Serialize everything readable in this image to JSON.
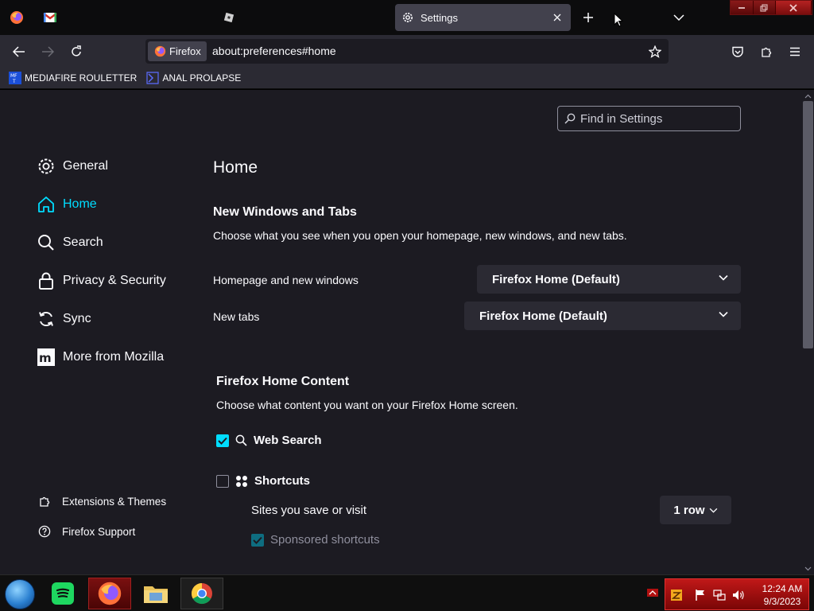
{
  "browser": {
    "active_tab_title": "Settings",
    "identity_label": "Firefox",
    "url": "about:preferences#home"
  },
  "bookmarks": [
    {
      "label": "MEDIAFIRE ROULETTER",
      "icon": "mediafire-icon"
    },
    {
      "label": "ANAL PROLAPSE",
      "icon": "bookmark-page-icon"
    }
  ],
  "settings": {
    "search_placeholder": "Find in Settings",
    "categories": [
      {
        "label": "General",
        "icon": "gear-icon",
        "selected": false
      },
      {
        "label": "Home",
        "icon": "home-icon",
        "selected": true
      },
      {
        "label": "Search",
        "icon": "search-icon",
        "selected": false
      },
      {
        "label": "Privacy & Security",
        "icon": "lock-icon",
        "selected": false
      },
      {
        "label": "Sync",
        "icon": "sync-icon",
        "selected": false
      },
      {
        "label": "More from Mozilla",
        "icon": "mozilla-icon",
        "selected": false
      }
    ],
    "footer_links": [
      {
        "label": "Extensions & Themes",
        "icon": "puzzle-icon"
      },
      {
        "label": "Firefox Support",
        "icon": "help-icon"
      }
    ],
    "page_title": "Home",
    "windows_tabs": {
      "heading": "New Windows and Tabs",
      "description": "Choose what you see when you open your homepage, new windows, and new tabs.",
      "homepage_label": "Homepage and new windows",
      "homepage_value": "Firefox Home (Default)",
      "newtabs_label": "New tabs",
      "newtabs_value": "Firefox Home (Default)"
    },
    "home_content": {
      "heading": "Firefox Home Content",
      "description": "Choose what content you want on your Firefox Home screen.",
      "web_search_label": "Web Search",
      "web_search_checked": true,
      "shortcuts_label": "Shortcuts",
      "shortcuts_checked": false,
      "sites_label": "Sites you save or visit",
      "rows_value": "1 row",
      "sponsored_label": "Sponsored shortcuts",
      "sponsored_checked": true
    }
  },
  "taskbar": {
    "time": "12:24 AM",
    "date": "9/3/2023"
  },
  "colors": {
    "accent": "#00ddff",
    "content_bg": "#1c1b22",
    "toolbar_bg": "#2b2a33",
    "tray_red": "#c01818"
  }
}
